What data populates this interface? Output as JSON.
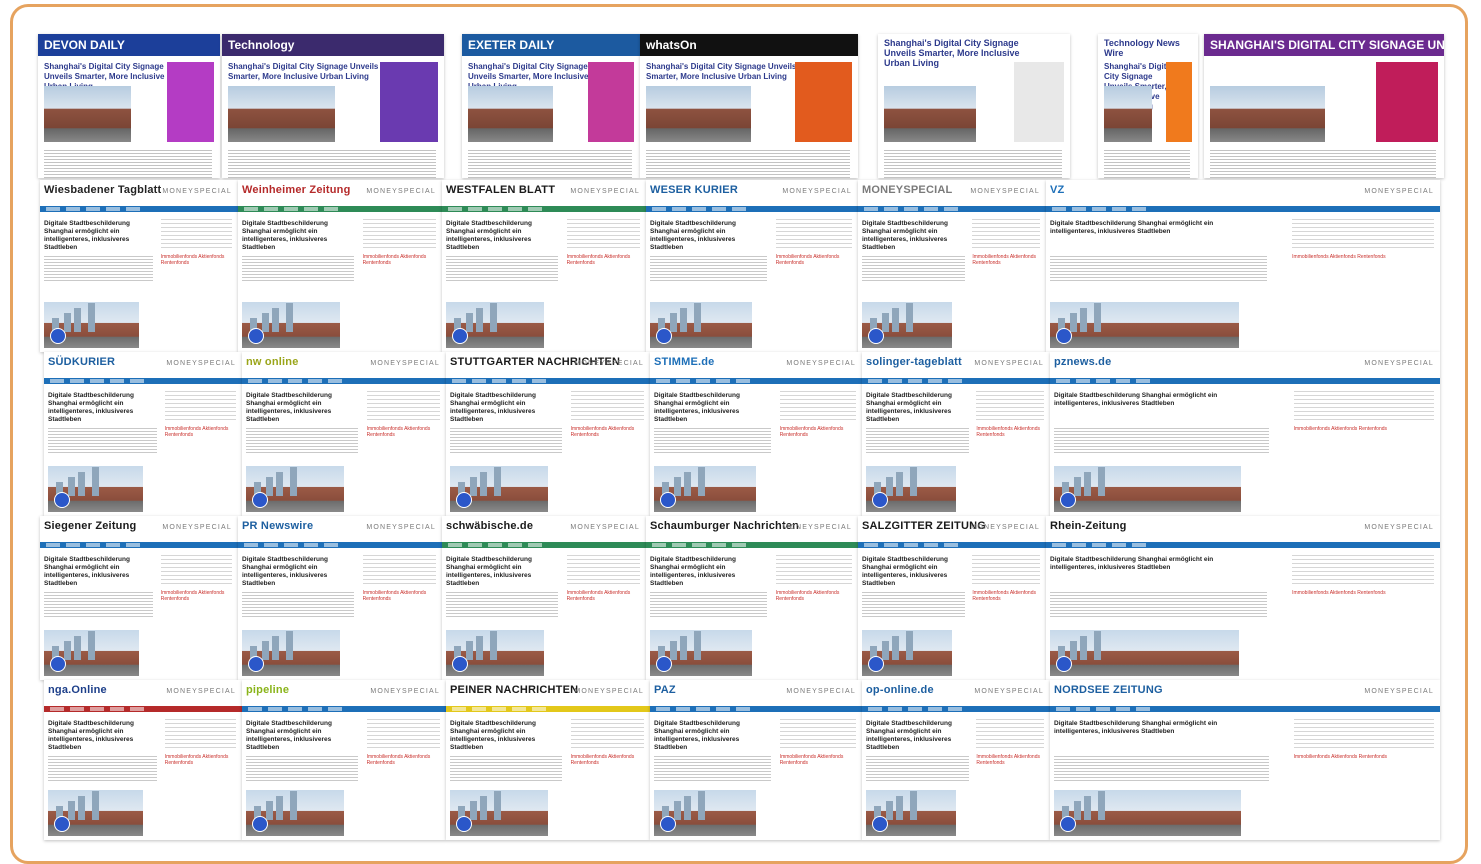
{
  "collage": {
    "accent_border": "#e6a35f",
    "feature_row": [
      {
        "name": "devon-daily",
        "logo": "DEVON DAILY",
        "title": "Shanghai's Digital City Signage Unveils Smarter, More Inclusive Urban Living",
        "hero": "#1c3f9a",
        "ad": "#b43cc4"
      },
      {
        "name": "technology",
        "logo": "Technology",
        "title": "Shanghai's Digital City Signage Unveils Smarter, More Inclusive Urban Living",
        "hero": "#3b2a6d",
        "ad": "#6a3ab0"
      },
      {
        "name": "exeter-daily",
        "logo": "EXETER DAILY",
        "title": "Shanghai's Digital City Signage Unveils Smarter, More Inclusive Urban Living",
        "hero": "#1c5aa0",
        "ad": "#c33a9a"
      },
      {
        "name": "whats-on",
        "logo": "whatsOn",
        "title": "Shanghai's Digital City Signage Unveils Smarter, More Inclusive Urban Living",
        "hero": "#111111",
        "ad": "#e25b1e"
      },
      {
        "name": "shanghai-daily-feature",
        "logo": "Shanghai's Digital City Signage Unveils Smarter, More Inclusive Urban Living",
        "title": "",
        "hero": "#ffffff",
        "ad": "#e8e8e8"
      },
      {
        "name": "technology-news-wire",
        "logo": "Technology News Wire",
        "title": "Shanghai's Digital City Signage Unveils Smarter, More Inclusive Urban Living",
        "hero": "#ffffff",
        "ad": "#f07a1d"
      },
      {
        "name": "tech-feature",
        "logo": "SHANGHAI'S DIGITAL CITY SIGNAGE UNVEILS SMARTER, MORE INCLUSIVE URBAN LIVING",
        "title": "",
        "hero": "#6b2a8f",
        "ad": "#c01d5a"
      }
    ],
    "headline": "Digitale Stadtbeschilderung Shanghai ermöglicht ein intelligenteres, inklusiveres Stadtleben",
    "sidebar_link": "Immobilienfonds Aktienfonds Rentenfonds",
    "money_label": "MONEYSPECIAL",
    "tiles": [
      {
        "name": "wiesbadener-tagblatt",
        "logo": "Wiesbadener Tagblatt",
        "color": "#222222",
        "nav": "#1d6fb8"
      },
      {
        "name": "weinheimer-zeitung",
        "logo": "Weinheimer Zeitung",
        "color": "#b52a2a",
        "nav": "#2e8b57"
      },
      {
        "name": "westfalen-blatt",
        "logo": "WESTFALEN BLATT",
        "color": "#1a1a1a",
        "nav": "#2e8b57"
      },
      {
        "name": "weser-kurier",
        "logo": "WESER KURIER",
        "color": "#1d5fa0",
        "nav": "#1d6fb8"
      },
      {
        "name": "moneyspecial-a",
        "logo": "MONEYSPECIAL",
        "color": "#7a7a7a",
        "nav": "#1d6fb8"
      },
      {
        "name": "vz-online",
        "logo": "VZ",
        "color": "#1d6fb8",
        "nav": "#1d6fb8"
      },
      {
        "name": "suedkurier",
        "logo": "SÜDKURIER",
        "color": "#1d5fa0",
        "nav": "#1d6fb8"
      },
      {
        "name": "nw-online",
        "logo": "nw online",
        "color": "#9aa51a",
        "nav": "#1d6fb8"
      },
      {
        "name": "stuttgarter-nachrichten",
        "logo": "STUTTGARTER NACHRICHTEN",
        "color": "#1a1a1a",
        "nav": "#1d6fb8"
      },
      {
        "name": "stimme-de",
        "logo": "STIMME.de",
        "color": "#1d6fb8",
        "nav": "#1d6fb8"
      },
      {
        "name": "solinger-tageblatt",
        "logo": "solinger-tageblatt",
        "color": "#1d5fa0",
        "nav": "#1d6fb8"
      },
      {
        "name": "pz-news",
        "logo": "pznews.de",
        "color": "#1d5fa0",
        "nav": "#1d6fb8"
      },
      {
        "name": "siegener-zeitung",
        "logo": "Siegener Zeitung",
        "color": "#1a1a1a",
        "nav": "#1d6fb8"
      },
      {
        "name": "pr-newswire",
        "logo": "PR Newswire",
        "color": "#1d5fa0",
        "nav": "#1d6fb8"
      },
      {
        "name": "schwaebische",
        "logo": "schwäbische.de",
        "color": "#1a1a1a",
        "nav": "#2e8b57"
      },
      {
        "name": "schaumburger",
        "logo": "Schaumburger Nachrichten",
        "color": "#1a1a1a",
        "nav": "#2e8b57"
      },
      {
        "name": "salzgitter-zeitung",
        "logo": "SALZGITTER ZEITUNG",
        "color": "#1a1a1a",
        "nav": "#1d6fb8"
      },
      {
        "name": "rhein-zeitung",
        "logo": "Rhein-Zeitung",
        "color": "#1a1a1a",
        "nav": "#1d6fb8"
      },
      {
        "name": "nga-online",
        "logo": "nga.Online",
        "color": "#1d3f8a",
        "nav": "#b52a2a"
      },
      {
        "name": "pipeline",
        "logo": "pipeline",
        "color": "#8ab41a",
        "nav": "#1d6fb8"
      },
      {
        "name": "peiner-nachrichten",
        "logo": "PEINER NACHRICHTEN",
        "color": "#1a1a1a",
        "nav": "#e3c81a"
      },
      {
        "name": "paz-online",
        "logo": "PAZ",
        "color": "#1d5fa0",
        "nav": "#1d6fb8"
      },
      {
        "name": "op-online",
        "logo": "op-online.de",
        "color": "#1d5fa0",
        "nav": "#1d6fb8"
      },
      {
        "name": "nordsee-zeitung",
        "logo": "NORDSEE ZEITUNG",
        "color": "#1d5fa0",
        "nav": "#1d6fb8"
      }
    ]
  }
}
